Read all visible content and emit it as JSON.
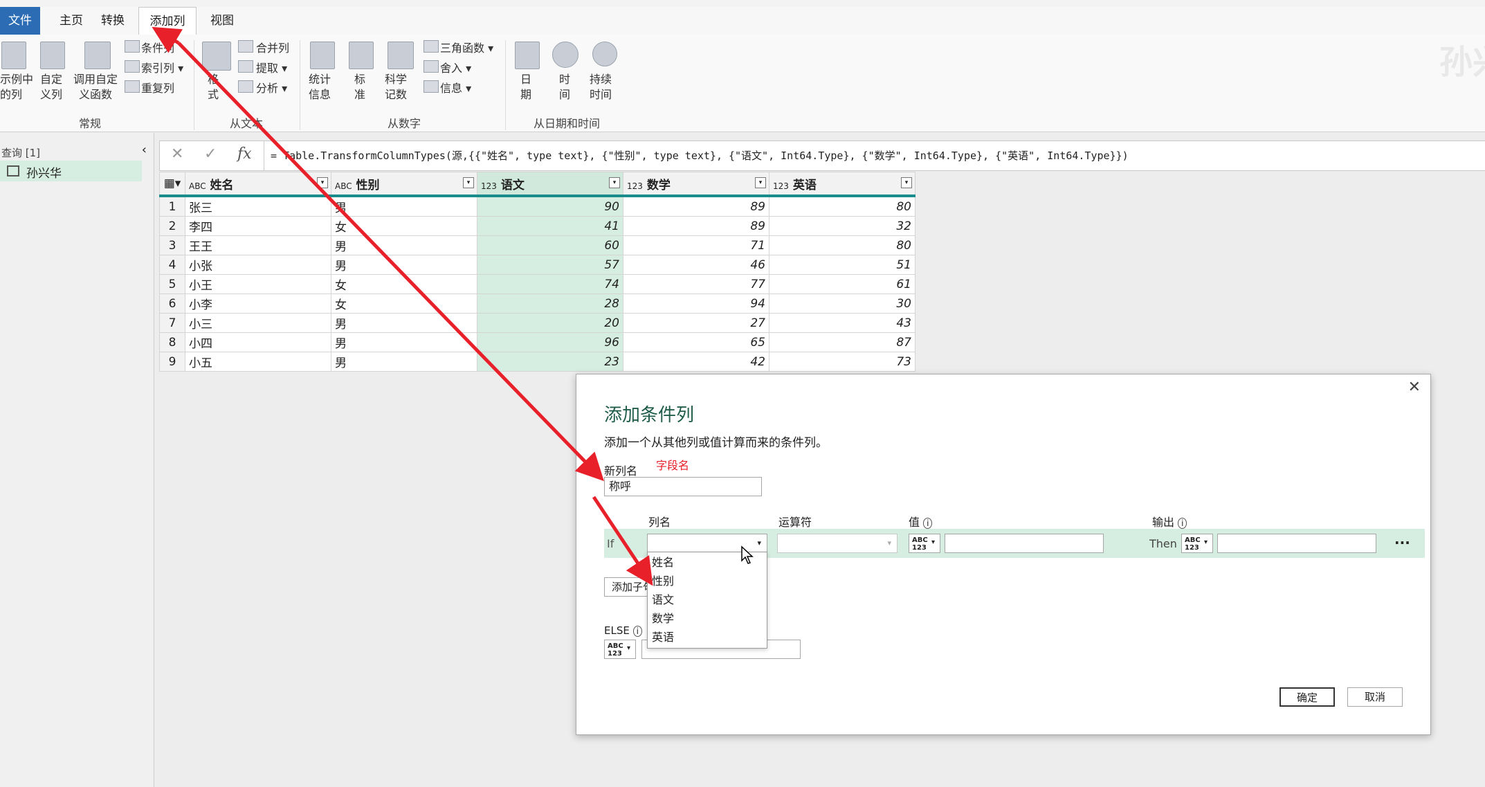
{
  "tabs": [
    "文件",
    "主页",
    "转换",
    "添加列",
    "视图"
  ],
  "ribbon": {
    "examples_col": "示例中\n的列",
    "custom_col": "自定\n义列",
    "invoke_func": "调用自定\n义函数",
    "cond_col": "条件列",
    "index_col": "索引列",
    "dup_col": "重复列",
    "group_general": "常规",
    "format": "格\n式",
    "merge_col": "合并列",
    "extract": "提取",
    "parse": "分析",
    "group_text": "从文本",
    "statistics": "统计\n信息",
    "standard": "标\n准",
    "scientific": "科学\n记数",
    "trig": "三角函数",
    "rounding": "舍入",
    "information": "信息",
    "group_number": "从数字",
    "date": "日\n期",
    "time": "时\n间",
    "duration": "持续\n时间",
    "group_datetime": "从日期和时间",
    "watermark": "孙兴"
  },
  "left_panel": {
    "title": "查询 [1]",
    "query_name": "孙兴华"
  },
  "formula": "= Table.TransformColumnTypes(源,{{\"姓名\", type text}, {\"性别\", type text}, {\"语文\", Int64.Type}, {\"数学\", Int64.Type}, {\"英语\", Int64.Type}})",
  "table": {
    "columns": [
      {
        "type": "ABC",
        "name": "姓名"
      },
      {
        "type": "ABC",
        "name": "性别"
      },
      {
        "type": "123",
        "name": "语文"
      },
      {
        "type": "123",
        "name": "数学"
      },
      {
        "type": "123",
        "name": "英语"
      }
    ],
    "rows": [
      [
        "张三",
        "男",
        "90",
        "89",
        "80"
      ],
      [
        "李四",
        "女",
        "41",
        "89",
        "32"
      ],
      [
        "王王",
        "男",
        "60",
        "71",
        "80"
      ],
      [
        "小张",
        "男",
        "57",
        "46",
        "51"
      ],
      [
        "小王",
        "女",
        "74",
        "77",
        "61"
      ],
      [
        "小李",
        "女",
        "28",
        "94",
        "30"
      ],
      [
        "小三",
        "男",
        "20",
        "27",
        "43"
      ],
      [
        "小四",
        "男",
        "96",
        "65",
        "87"
      ],
      [
        "小五",
        "男",
        "23",
        "42",
        "73"
      ]
    ]
  },
  "dialog": {
    "title": "添加条件列",
    "description": "添加一个从其他列或值计算而来的条件列。",
    "new_col_label": "新列名",
    "annotation": "字段名",
    "new_col_value": "称呼",
    "col_header_name": "列名",
    "col_header_operator": "运算符",
    "col_header_value": "值",
    "col_header_output": "输出",
    "if_label": "If",
    "then_label": "Then",
    "more": "···",
    "add_clause": "添加子句",
    "else_label": "ELSE",
    "type_abc": "ABC",
    "type_123": "123",
    "ok": "确定",
    "cancel": "取消",
    "close": "✕",
    "dropdown_items": [
      "姓名",
      "性别",
      "语文",
      "数学",
      "英语"
    ]
  },
  "colors": {
    "accent": "#1a8c8c",
    "highlight": "#d6eee2",
    "arrow": "#e8202a"
  }
}
